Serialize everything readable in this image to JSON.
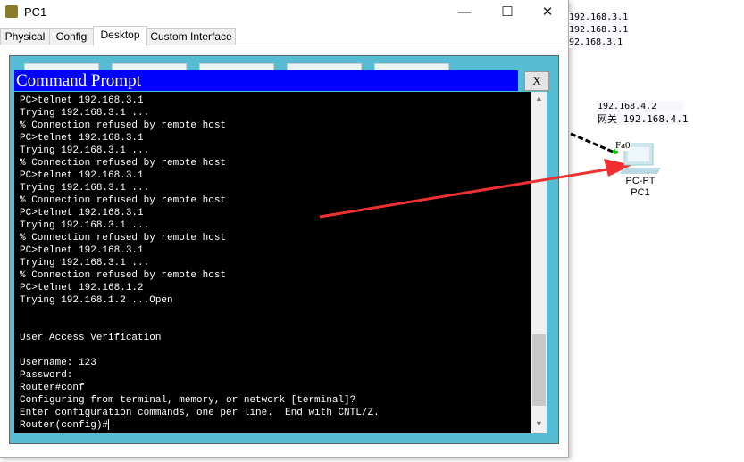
{
  "window": {
    "title": "PC1",
    "controls": {
      "minimize": "—",
      "maximize": "☐",
      "close": "✕"
    }
  },
  "tabs": [
    {
      "label": "Physical"
    },
    {
      "label": "Config"
    },
    {
      "label": "Desktop",
      "active": true
    },
    {
      "label": "Custom Interface"
    }
  ],
  "command_prompt": {
    "title": "Command Prompt",
    "close_label": "X",
    "lines": [
      "PC>telnet 192.168.3.1",
      "Trying 192.168.3.1 ...",
      "% Connection refused by remote host",
      "PC>telnet 192.168.3.1",
      "Trying 192.168.3.1 ...",
      "% Connection refused by remote host",
      "PC>telnet 192.168.3.1",
      "Trying 192.168.3.1 ...",
      "% Connection refused by remote host",
      "PC>telnet 192.168.3.1",
      "Trying 192.168.3.1 ...",
      "% Connection refused by remote host",
      "PC>telnet 192.168.3.1",
      "Trying 192.168.3.1 ...",
      "% Connection refused by remote host",
      "PC>telnet 192.168.1.2",
      "Trying 192.168.1.2 ...Open",
      "",
      "",
      "User Access Verification",
      "",
      "Username: 123",
      "Password:",
      "Router#conf",
      "Configuring from terminal, memory, or network [terminal]?",
      "Enter configuration commands, one per line.  End with CNTL/Z."
    ],
    "prompt": "Router(config)#"
  },
  "topology": {
    "ip_labels": [
      "192.168.3.1",
      "192.168.3.1",
      "92.168.3.1"
    ],
    "pc_ip": "192.168.4.2",
    "gateway": "网关 192.168.4.1",
    "port": "Fa0",
    "device_type": "PC-PT",
    "device_name": "PC1"
  },
  "colors": {
    "title_bar": "#0000ff",
    "desktop": "#56bcd3",
    "arrow": "#f03030",
    "link_up": "#00cc00"
  }
}
